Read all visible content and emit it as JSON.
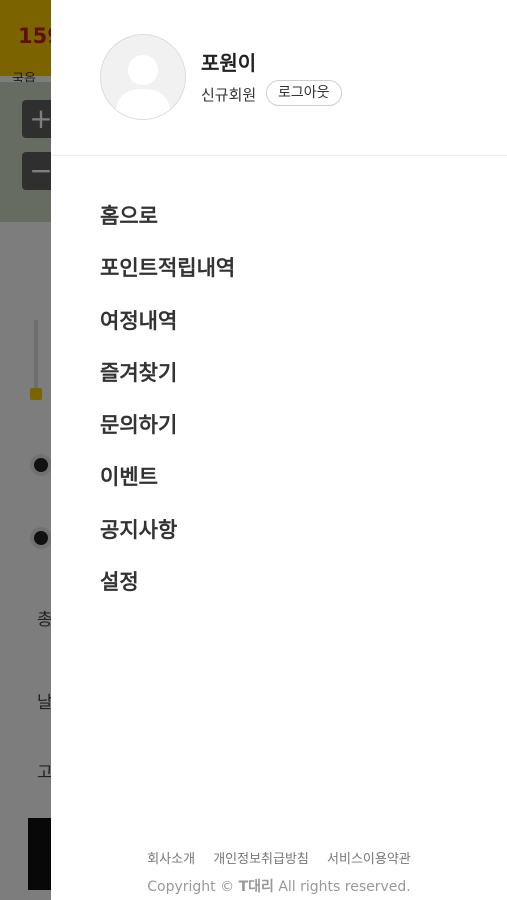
{
  "background": {
    "phone_partial": "159",
    "sub_partial": "국읍",
    "side_text_1": "총",
    "side_text_2": "날",
    "side_text_3": "고"
  },
  "profile": {
    "user_name": "포원이",
    "member_type": "신규회원",
    "logout_label": "로그아웃",
    "avatar_icon": "user-placeholder-icon"
  },
  "menu": {
    "items": [
      {
        "label": "홈으로"
      },
      {
        "label": "포인트적립내역"
      },
      {
        "label": "여정내역"
      },
      {
        "label": "즐겨찾기"
      },
      {
        "label": "문의하기"
      },
      {
        "label": "이벤트"
      },
      {
        "label": "공지사항"
      },
      {
        "label": "설정"
      }
    ]
  },
  "footer": {
    "links": [
      {
        "label": "회사소개"
      },
      {
        "label": "개인정보취급방침"
      },
      {
        "label": "서비스이용약관"
      }
    ],
    "copyright_prefix": "Copyright © ",
    "brand": "T대리",
    "copyright_suffix": " All rights reserved."
  },
  "colors": {
    "accent": "#f7c600",
    "overlay": "rgba(0,0,0,0.5)"
  }
}
